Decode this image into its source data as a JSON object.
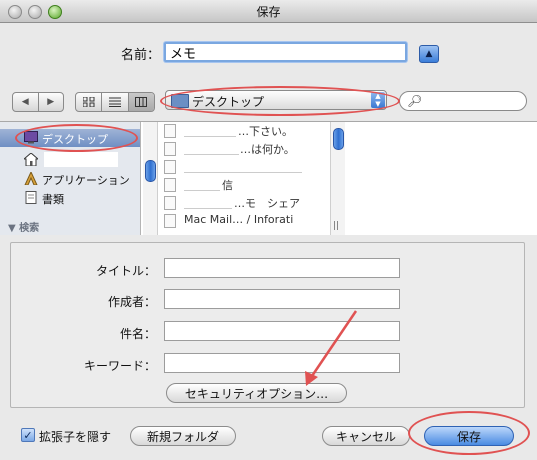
{
  "window": {
    "title": "保存"
  },
  "save_as": {
    "label": "名前：",
    "value": "メモ"
  },
  "toolbar": {
    "back_glyph": "◀",
    "forward_glyph": "▶",
    "view_icons": [
      "icon-view-icon",
      "list-view-icon",
      "column-view-icon"
    ],
    "location": "デスクトップ",
    "search_placeholder": ""
  },
  "sidebar": {
    "items": [
      {
        "label": "デスクトップ",
        "icon": "desktop-icon",
        "selected": true
      },
      {
        "label": "",
        "icon": "home-icon",
        "selected": false
      },
      {
        "label": "アプリケーション",
        "icon": "applications-icon",
        "selected": false
      },
      {
        "label": "書類",
        "icon": "documents-icon",
        "selected": false
      }
    ],
    "search_header": "▼ 検索"
  },
  "files": [
    {
      "name": "…下さい。"
    },
    {
      "name": "…は何か。"
    },
    {
      "name": ""
    },
    {
      "name": "信"
    },
    {
      "name": "…モ　シェア"
    },
    {
      "name": "Mac Mail… / Inforati"
    }
  ],
  "options": {
    "title_label": "タイトル：",
    "author_label": "作成者：",
    "subject_label": "件名：",
    "keywords_label": "キーワード：",
    "title_value": "",
    "author_value": "",
    "subject_value": "",
    "keywords_value": "",
    "security_button": "セキュリティオプション…"
  },
  "bottom": {
    "hide_extension_checked": true,
    "hide_extension_label": "拡張子を隠す",
    "new_folder": "新規フォルダ",
    "cancel": "キャンセル",
    "save": "保存"
  },
  "colors": {
    "annotation": "#e05252",
    "accent": "#3a78d2"
  }
}
